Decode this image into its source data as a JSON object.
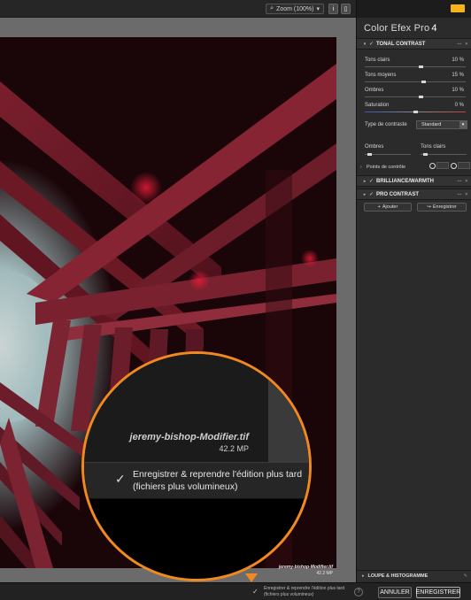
{
  "toolbar": {
    "zoom_label": "Zoom (100%)",
    "zoom_arrow": "▾",
    "info_button": "i",
    "compare_button": "▯"
  },
  "photo": {
    "filename": "jeremy-bishop-Modifier.tif",
    "size": "42.2 MP"
  },
  "magnifier": {
    "filename": "jeremy-bishop-Modifier.tif",
    "size": "42.2 MP",
    "checkbox_mark": "✓",
    "save_text_line1": "Enregistrer & reprendre l'édition plus tard",
    "save_text_line2": "(fichiers plus volumineux)"
  },
  "panel": {
    "app_title": "Color Efex Pro",
    "app_version": "4",
    "filters": [
      {
        "name": "TONAL CONTRAST",
        "expanded": true,
        "checked": true
      },
      {
        "name": "BRILLIANCE/WARMTH",
        "expanded": false,
        "checked": true
      },
      {
        "name": "PRO CONTRAST",
        "expanded": false,
        "checked": true
      }
    ],
    "sliders": [
      {
        "label": "Tons clairs",
        "value": "10 %",
        "fraction": 0.55
      },
      {
        "label": "Tons moyens",
        "value": "15 %",
        "fraction": 0.575
      },
      {
        "label": "Ombres",
        "value": "10 %",
        "fraction": 0.55
      },
      {
        "label": "Saturation",
        "value": "0 %",
        "fraction": 0.5
      }
    ],
    "contrast_type_label": "Type de contraste",
    "contrast_type_value": "Standard",
    "protect": {
      "shadows_label": "Ombres",
      "highlights_label": "Tons clairs"
    },
    "control_points_label": "Points de contrôle",
    "add_button": "Ajouter",
    "save_button": "Enregistrer",
    "add_icon": "+",
    "save_icon": "↪",
    "loupe_label": "LOUPE & HISTOGRAMME"
  },
  "bottom": {
    "save_check": "✓",
    "save_text_line1": "Enregistrer & reprendre l'édition plus tard",
    "save_text_line2": "(fichiers plus volumineux)",
    "help_icon": "?",
    "cancel_button": "ANNULER",
    "save_button": "ENREGISTRER"
  },
  "colors": {
    "accent_orange": "#f0891f",
    "nik_badge": "#f6b21a",
    "photo_red": "#8c1e2c"
  }
}
